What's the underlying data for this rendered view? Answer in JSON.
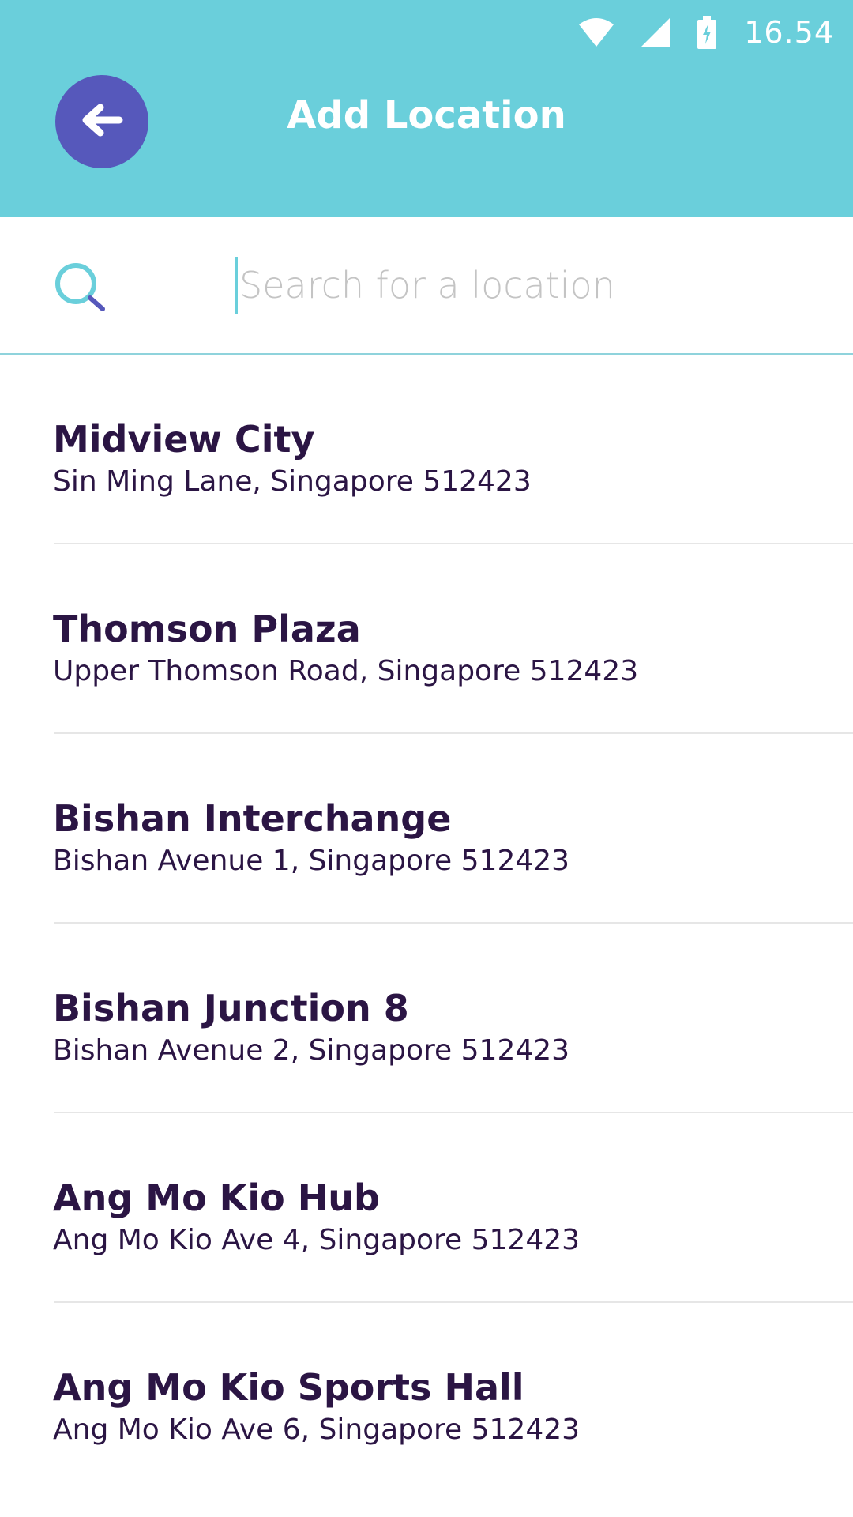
{
  "status_bar": {
    "time": "16.54",
    "icons": [
      "wifi-icon",
      "cellular-signal-icon",
      "battery-charging-icon"
    ]
  },
  "header": {
    "title": "Add Location",
    "back_icon": "arrow-left-icon",
    "background_color": "#6acfdb",
    "back_button_color": "#5658bb"
  },
  "search": {
    "icon": "search-icon",
    "placeholder": "Search for a location",
    "value": ""
  },
  "locations": [
    {
      "name": "Midview City",
      "address": "Sin Ming Lane, Singapore 512423"
    },
    {
      "name": "Thomson Plaza",
      "address": "Upper Thomson Road, Singapore 512423"
    },
    {
      "name": "Bishan Interchange",
      "address": "Bishan Avenue 1, Singapore 512423"
    },
    {
      "name": "Bishan Junction 8",
      "address": "Bishan Avenue 2, Singapore 512423"
    },
    {
      "name": "Ang Mo Kio Hub",
      "address": "Ang Mo Kio Ave 4, Singapore 512423"
    },
    {
      "name": "Ang Mo Kio Sports Hall",
      "address": "Ang Mo Kio Ave 6, Singapore 512423"
    }
  ],
  "colors": {
    "text_primary": "#2b1544",
    "divider": "#e6e6e6",
    "search_accent": "#6acfdb",
    "search_handle": "#5658bb"
  }
}
